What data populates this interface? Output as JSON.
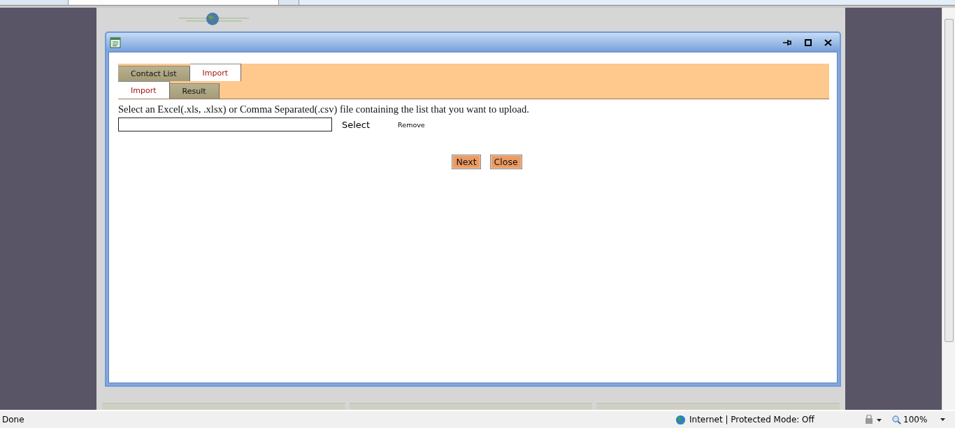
{
  "tabs": [
    {
      "label": "Contact List",
      "selected": false
    },
    {
      "label": "Import",
      "selected": true
    }
  ],
  "subtabs": [
    {
      "label": "Import",
      "selected": true
    },
    {
      "label": "Result",
      "selected": false
    }
  ],
  "instructions": "Select an Excel(.xls, .xlsx) or Comma Separated(.csv) file containing the list that you want to upload.",
  "select_label": "Select",
  "remove_label": "Remove",
  "actions": [
    "Next",
    "Close"
  ],
  "status_bar": {
    "text": "Done",
    "zone": "Internet | Protected Mode: Off",
    "zoom": "100%"
  }
}
